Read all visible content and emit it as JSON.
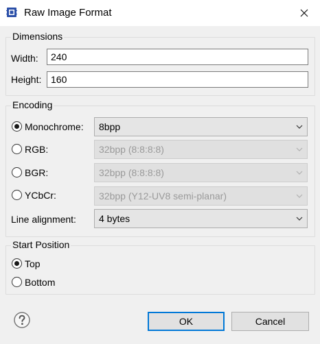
{
  "window": {
    "title": "Raw Image Format"
  },
  "dimensions": {
    "legend": "Dimensions",
    "width_label": "Width:",
    "width_value": "240",
    "height_label": "Height:",
    "height_value": "160"
  },
  "encoding": {
    "legend": "Encoding",
    "options": [
      {
        "label": "Monochrome:",
        "selected": true,
        "format": "8bpp",
        "enabled": true
      },
      {
        "label": "RGB:",
        "selected": false,
        "format": "32bpp (8:8:8:8)",
        "enabled": false
      },
      {
        "label": "BGR:",
        "selected": false,
        "format": "32bpp (8:8:8:8)",
        "enabled": false
      },
      {
        "label": "YCbCr:",
        "selected": false,
        "format": "32bpp (Y12-UV8 semi-planar)",
        "enabled": false
      }
    ],
    "line_alignment_label": "Line alignment:",
    "line_alignment_value": "4 bytes"
  },
  "start_position": {
    "legend": "Start Position",
    "options": [
      {
        "label": "Top",
        "selected": true
      },
      {
        "label": "Bottom",
        "selected": false
      }
    ]
  },
  "buttons": {
    "ok": "OK",
    "cancel": "Cancel"
  },
  "icons": {
    "app": "raw-image-app-icon",
    "close": "close-icon",
    "help": "help-icon",
    "dropdown": "chevron-down-icon"
  },
  "colors": {
    "accent": "#0078d7",
    "background": "#f0f0f0"
  }
}
